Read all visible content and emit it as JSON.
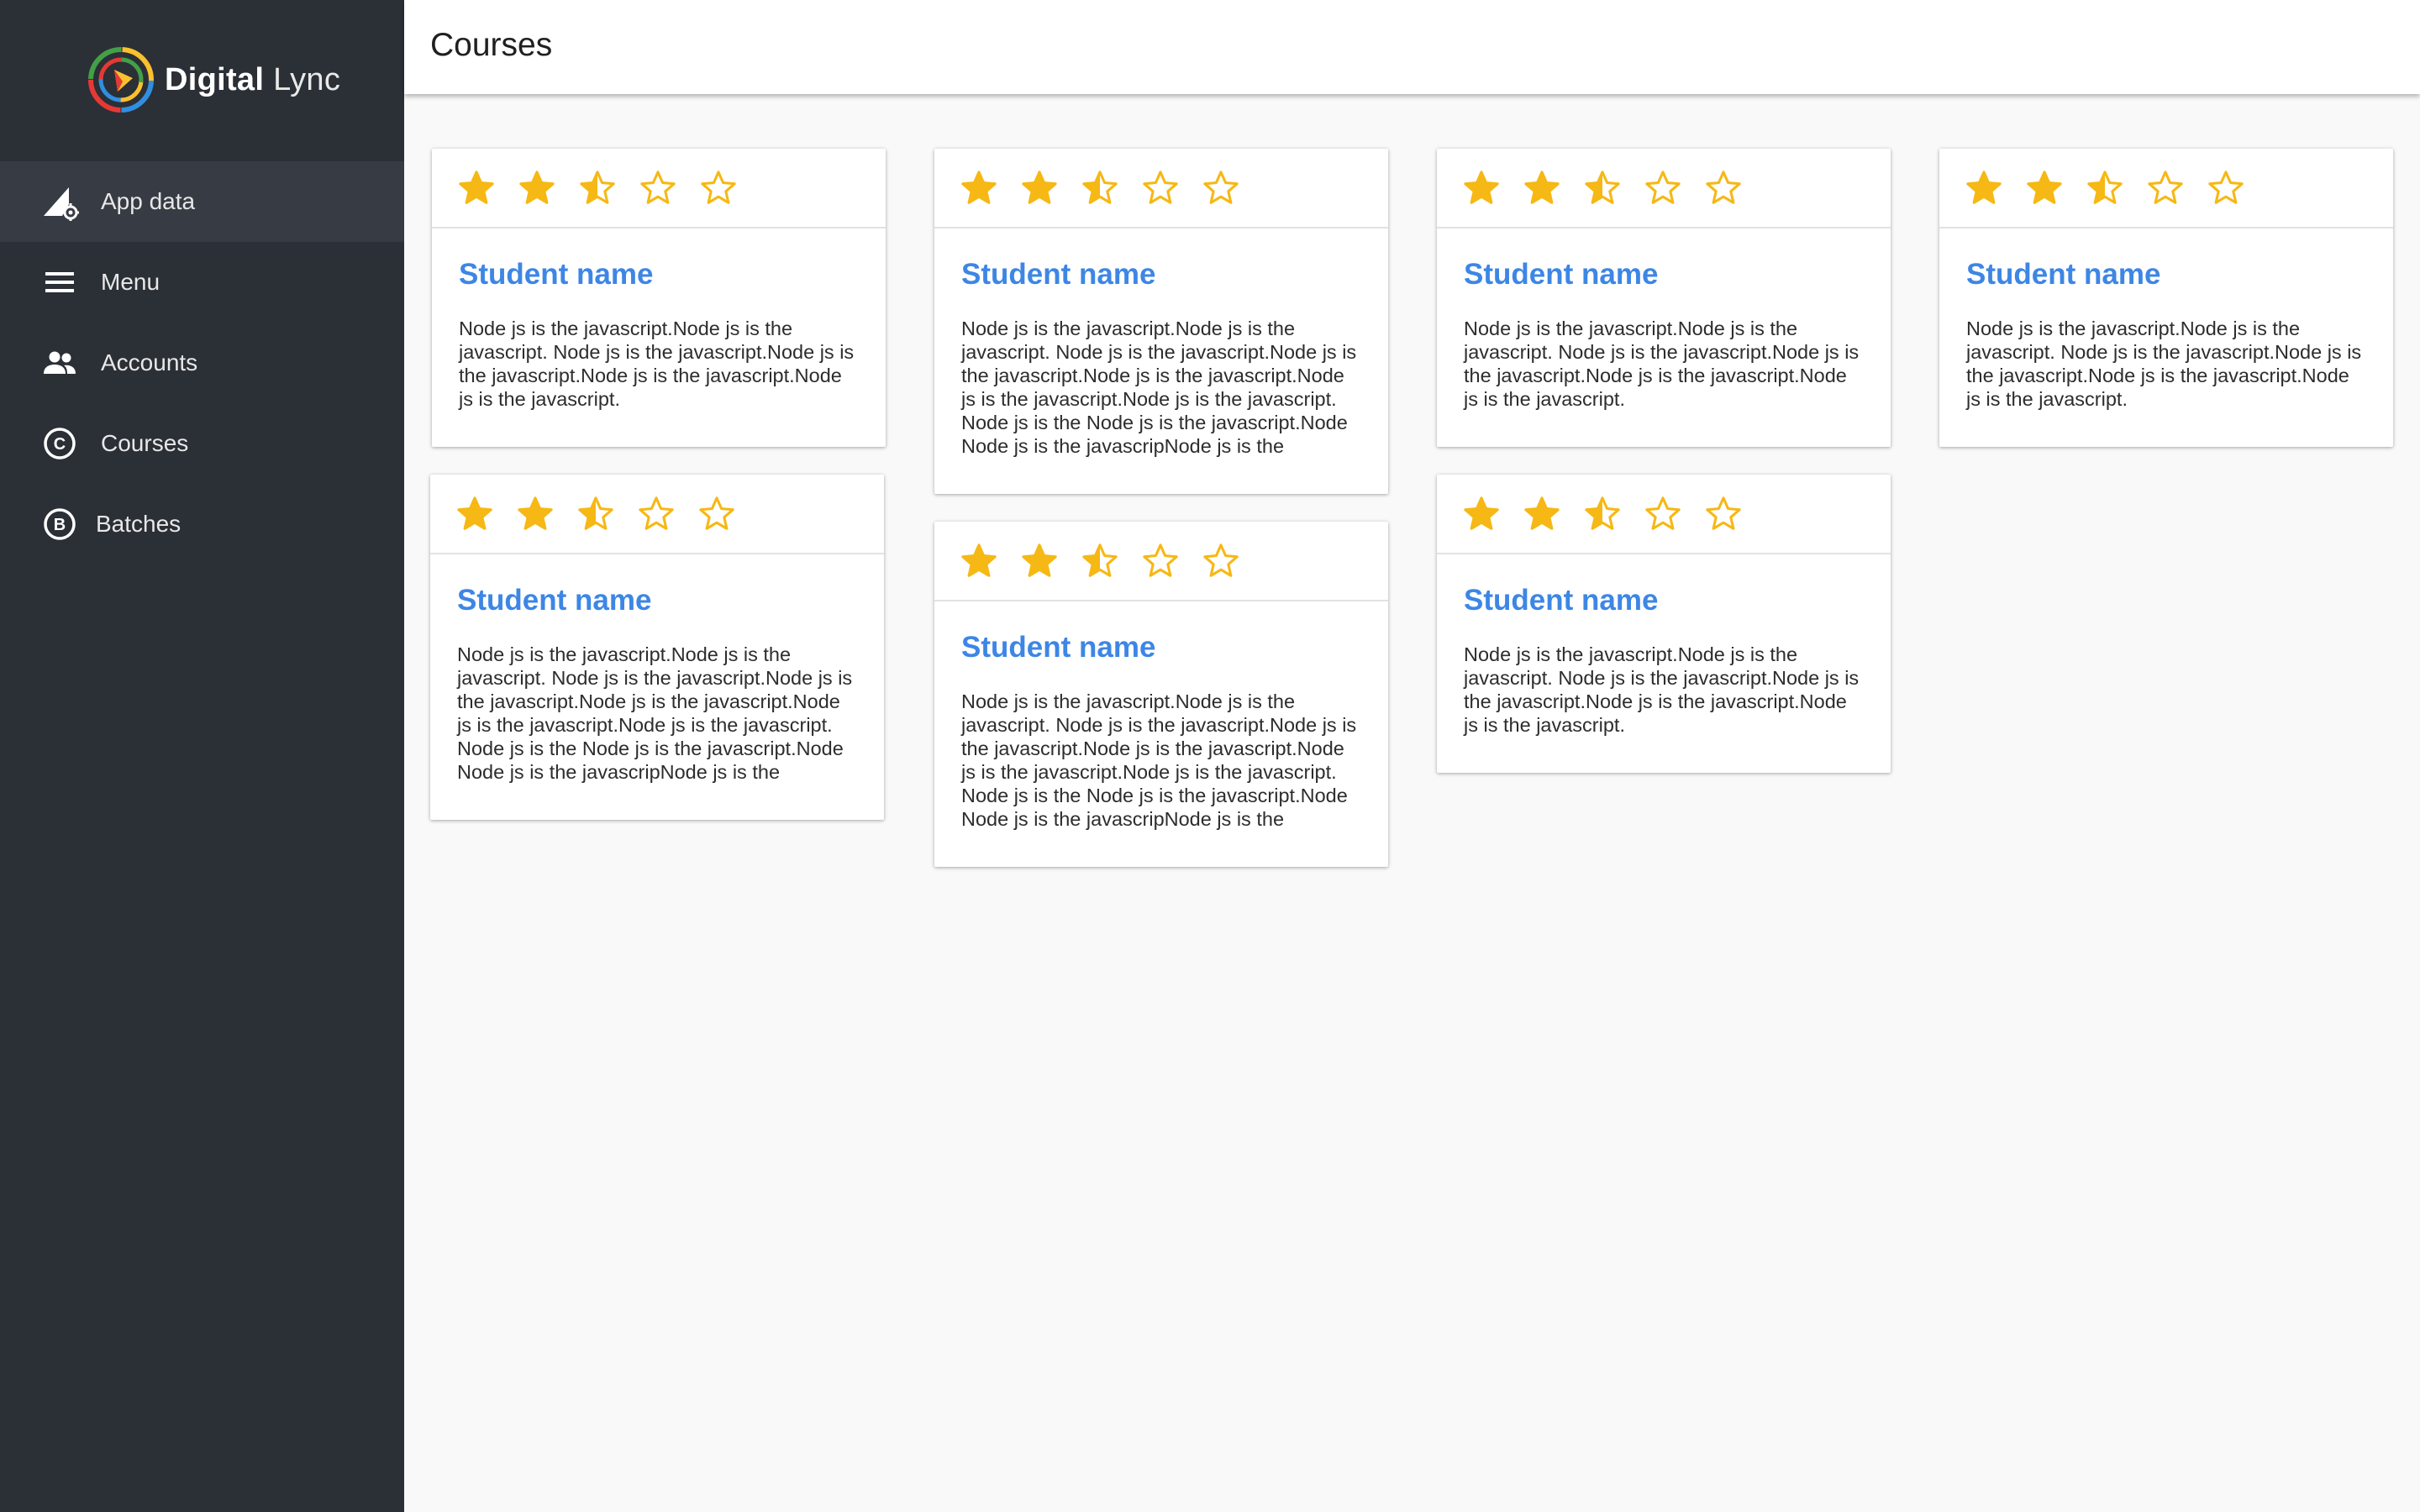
{
  "app": {
    "logo_bold": "Digital",
    "logo_light": " Lync"
  },
  "sidebar": {
    "items": [
      {
        "label": "App data",
        "icon": "app-data-icon",
        "active": true
      },
      {
        "label": "Menu",
        "icon": "menu-icon",
        "active": false
      },
      {
        "label": "Accounts",
        "icon": "accounts-icon",
        "active": false
      },
      {
        "label": "Courses",
        "icon": "courses-icon",
        "active": false
      },
      {
        "label": "Batches",
        "icon": "batches-icon",
        "active": false
      }
    ]
  },
  "header": {
    "title": "Courses"
  },
  "cards": [
    {
      "rating": 2.5,
      "title": "Student name",
      "text": "Node js is the javascript.Node js is the javascript. Node js is the javascript.Node js is the javascript.Node js is the javascript.Node js is the javascript."
    },
    {
      "rating": 2.5,
      "title": "Student name",
      "text": "Node js is the javascript.Node js is the javascript. Node js is the javascript.Node js is the javascript.Node js is the javascript.Node js is the javascript.Node js is the javascript. Node js is the Node js is the javascript.Node Node js is the javascripNode js is the"
    },
    {
      "rating": 2.5,
      "title": "Student name",
      "text": "Node js is the javascript.Node js is the javascript. Node js is the javascript.Node js is the javascript.Node js is the javascript.Node js is the javascript."
    },
    {
      "rating": 2.5,
      "title": "Student name",
      "text": "Node js is the javascript.Node js is the javascript. Node js is the javascript.Node js is the javascript.Node js is the javascript.Node js is the javascript."
    },
    {
      "rating": 2.5,
      "title": "Student name",
      "text": "Node js is the javascript.Node js is the javascript. Node js is the javascript.Node js is the javascript.Node js is the javascript.Node js is the javascript.Node js is the javascript. Node js is the Node js is the javascript.Node Node js is the javascripNode js is the"
    },
    {
      "rating": 2.5,
      "title": "Student name",
      "text": "Node js is the javascript.Node js is the javascript. Node js is the javascript.Node js is the javascript.Node js is the javascript.Node js is the javascript.Node js is the javascript. Node js is the Node js is the javascript.Node Node js is the javascripNode js is the"
    },
    {
      "rating": 2.5,
      "title": "Student name",
      "text": "Node js is the javascript.Node js is the javascript. Node js is the javascript.Node js is the javascript.Node js is the javascript.Node js is the javascript."
    }
  ],
  "colors": {
    "sidebar_bg": "#2b2f36",
    "sidebar_active": "#373c44",
    "accent_title": "#3d86e5",
    "star": "#f6b814"
  }
}
